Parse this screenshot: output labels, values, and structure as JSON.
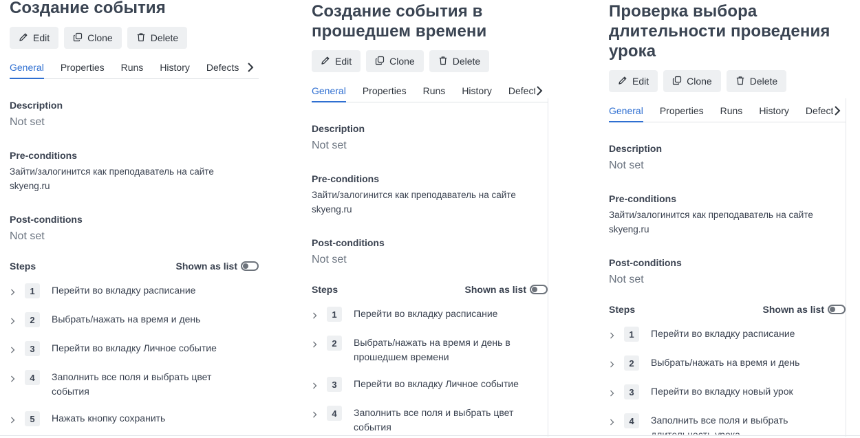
{
  "colors": {
    "accent": "#2f6fd1",
    "text": "#3a4250",
    "muted": "#6b7480",
    "button_bg": "#eef0f2"
  },
  "icons": {
    "edit": "pencil-icon",
    "clone": "copy-icon",
    "delete": "trash-icon",
    "tabs_more": "chevron-right-icon",
    "step_expand": "chevron-right-icon"
  },
  "common": {
    "buttons": {
      "edit": "Edit",
      "clone": "Clone",
      "delete": "Delete"
    },
    "tabs": [
      "General",
      "Properties",
      "Runs",
      "History",
      "Defects"
    ],
    "labels": {
      "description": "Description",
      "preconditions": "Pre-conditions",
      "postconditions": "Post-conditions",
      "steps": "Steps",
      "shown_as_list": "Shown as list"
    },
    "not_set": "Not set"
  },
  "panels": [
    {
      "title": "Создание события",
      "active_tab": "General",
      "description": "Not set",
      "preconditions": "Зайти/залогинится как преподаватель на сайте skyeng.ru",
      "postconditions": "Not set",
      "steps": [
        {
          "num": "1",
          "text": "Перейти во вкладку расписание"
        },
        {
          "num": "2",
          "text": "Выбрать/нажать на время и день"
        },
        {
          "num": "3",
          "text": "Перейти во вкладку Личное событие"
        },
        {
          "num": "4",
          "text": "Заполнить все поля и выбрать цвет события"
        },
        {
          "num": "5",
          "text": "Нажать кнопку сохранить"
        }
      ]
    },
    {
      "title": "Создание события в прошедшем времени",
      "active_tab": "General",
      "description": "Not set",
      "preconditions": "Зайти/залогинится как преподаватель на сайте skyeng.ru",
      "postconditions": "Not set",
      "steps": [
        {
          "num": "1",
          "text": "Перейти во вкладку расписание"
        },
        {
          "num": "2",
          "text": "Выбрать/нажать на время и день в прошедшем времени"
        },
        {
          "num": "3",
          "text": "Перейти во вкладку Личное событие"
        },
        {
          "num": "4",
          "text": "Заполнить все поля и выбрать цвет события"
        }
      ]
    },
    {
      "title": "Проверка выбора длительности проведения урока",
      "active_tab": "General",
      "description": "Not set",
      "preconditions": "Зайти/залогинится как преподаватель на сайте skyeng.ru",
      "postconditions": "Not set",
      "steps": [
        {
          "num": "1",
          "text": "Перейти во вкладку расписание"
        },
        {
          "num": "2",
          "text": "Выбрать/нажать на время и день"
        },
        {
          "num": "3",
          "text": "Перейти во вкладку новый урок"
        },
        {
          "num": "4",
          "text": "Заполнить все поля и выбрать длительность урока"
        }
      ]
    }
  ]
}
